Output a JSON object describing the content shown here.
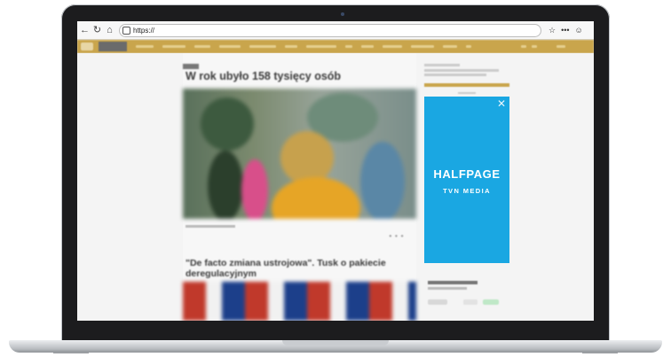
{
  "browser": {
    "url": "https://",
    "back_icon": "arrow-left-icon",
    "forward_icon": "arrow-right-icon",
    "reload_icon": "reload-icon",
    "home_icon": "home-icon",
    "right_icons": [
      "star-icon",
      "more-icon",
      "account-icon"
    ]
  },
  "article": {
    "headline": "W rok ubyło 158 tysięcy osób",
    "second_headline": "\"De facto zmiana ustrojowa\". Tusk o pakiecie deregulacyjnym"
  },
  "ad": {
    "title": "HALFPAGE",
    "subtitle": "TVN MEDIA",
    "close_icon": "close-icon"
  },
  "colors": {
    "nav_bar": "#c9a54c",
    "ad_background": "#1aa7e2",
    "laptop_bezel": "#1c1c1e"
  }
}
